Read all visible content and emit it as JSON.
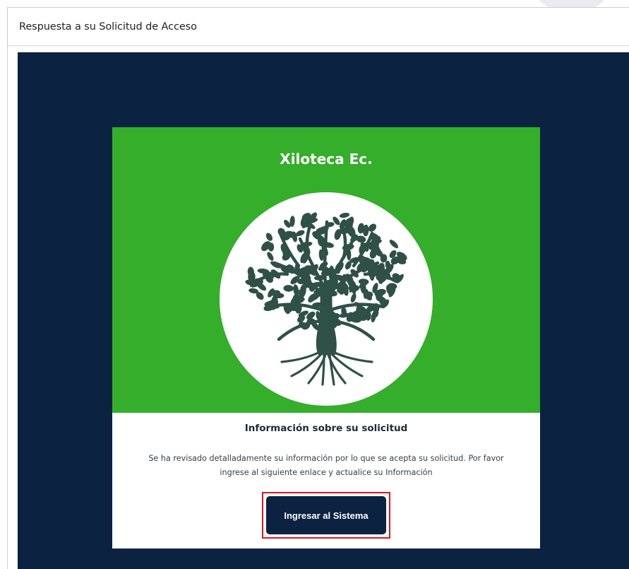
{
  "window": {
    "title": "Respuesta a su Solicitud de Acceso"
  },
  "email": {
    "brand_name": "Xiloteca Ec.",
    "logo_icon": "tree-of-life-icon",
    "heading": "Información sobre su solicitud",
    "message": "Se ha revisado detalladamente su información por lo que se acepta su solicitud. Por favor ingrese al siguiente enlace y actualice su Información",
    "button_label": "Ingresar al Sistema"
  },
  "colors": {
    "body_background": "#0b2240",
    "hero_green": "#35ae2b",
    "button_background": "#0b2240",
    "highlight_border": "#e0161d",
    "tree": "#2f5046"
  }
}
